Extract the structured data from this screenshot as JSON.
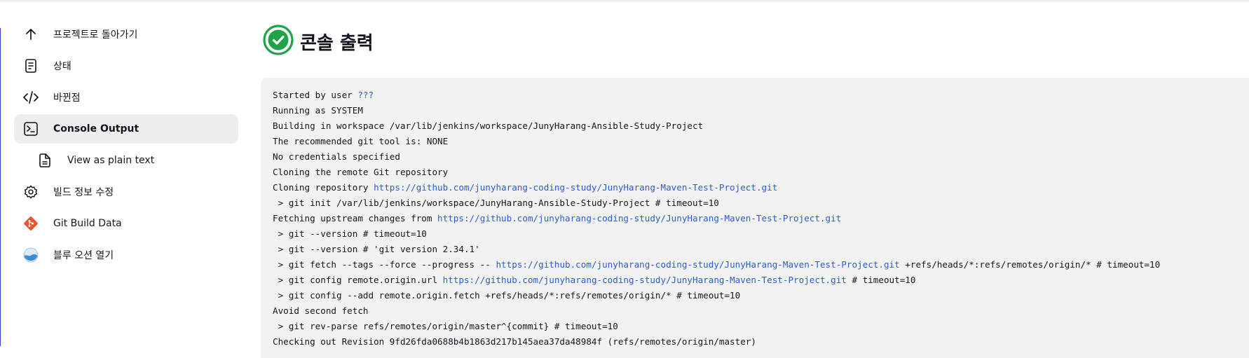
{
  "sidebar": {
    "items": [
      {
        "label": "프로젝트로 돌아가기",
        "icon": "arrow-up-icon"
      },
      {
        "label": "상태",
        "icon": "document-icon"
      },
      {
        "label": "바뀐점",
        "icon": "code-icon"
      },
      {
        "label": "Console Output",
        "icon": "terminal-icon",
        "active": true
      },
      {
        "label": "View as plain text",
        "icon": "file-icon"
      },
      {
        "label": "빌드 정보 수정",
        "icon": "gear-icon"
      },
      {
        "label": "Git Build Data",
        "icon": "git-icon"
      },
      {
        "label": "블루 오션 열기",
        "icon": "blue-ocean-icon"
      }
    ]
  },
  "header": {
    "title": "콘솔 출력",
    "status_icon": "success-check-icon",
    "status_color": "#1ea446"
  },
  "console": {
    "lines": [
      {
        "text": "Started by user ",
        "link": "???"
      },
      {
        "text": "Running as SYSTEM"
      },
      {
        "text": "Building in workspace /var/lib/jenkins/workspace/JunyHarang-Ansible-Study-Project"
      },
      {
        "text": "The recommended git tool is: NONE"
      },
      {
        "text": "No credentials specified"
      },
      {
        "text": "Cloning the remote Git repository"
      },
      {
        "text": "Cloning repository ",
        "link": "https://github.com/junyharang-coding-study/JunyHarang-Maven-Test-Project.git"
      },
      {
        "text": " > git init /var/lib/jenkins/workspace/JunyHarang-Ansible-Study-Project # timeout=10"
      },
      {
        "text": "Fetching upstream changes from ",
        "link": "https://github.com/junyharang-coding-study/JunyHarang-Maven-Test-Project.git"
      },
      {
        "text": " > git --version # timeout=10"
      },
      {
        "text": " > git --version # 'git version 2.34.1'"
      },
      {
        "text": " > git fetch --tags --force --progress -- ",
        "link": "https://github.com/junyharang-coding-study/JunyHarang-Maven-Test-Project.git",
        "after": " +refs/heads/*:refs/remotes/origin/* # timeout=10"
      },
      {
        "text": " > git config remote.origin.url ",
        "link": "https://github.com/junyharang-coding-study/JunyHarang-Maven-Test-Project.git",
        "after": " # timeout=10"
      },
      {
        "text": " > git config --add remote.origin.fetch +refs/heads/*:refs/remotes/origin/* # timeout=10"
      },
      {
        "text": "Avoid second fetch"
      },
      {
        "text": " > git rev-parse refs/remotes/origin/master^{commit} # timeout=10"
      },
      {
        "text": "Checking out Revision 9fd26fda0688b4b1863d217b145aea37da48984f (refs/remotes/origin/master)"
      }
    ]
  },
  "colors": {
    "link": "#2a5bd6",
    "active_bg": "#eeeeee",
    "console_bg": "#f2f2f2",
    "git_icon": "#e8542f",
    "blue_ocean": "#3b8bd8"
  }
}
